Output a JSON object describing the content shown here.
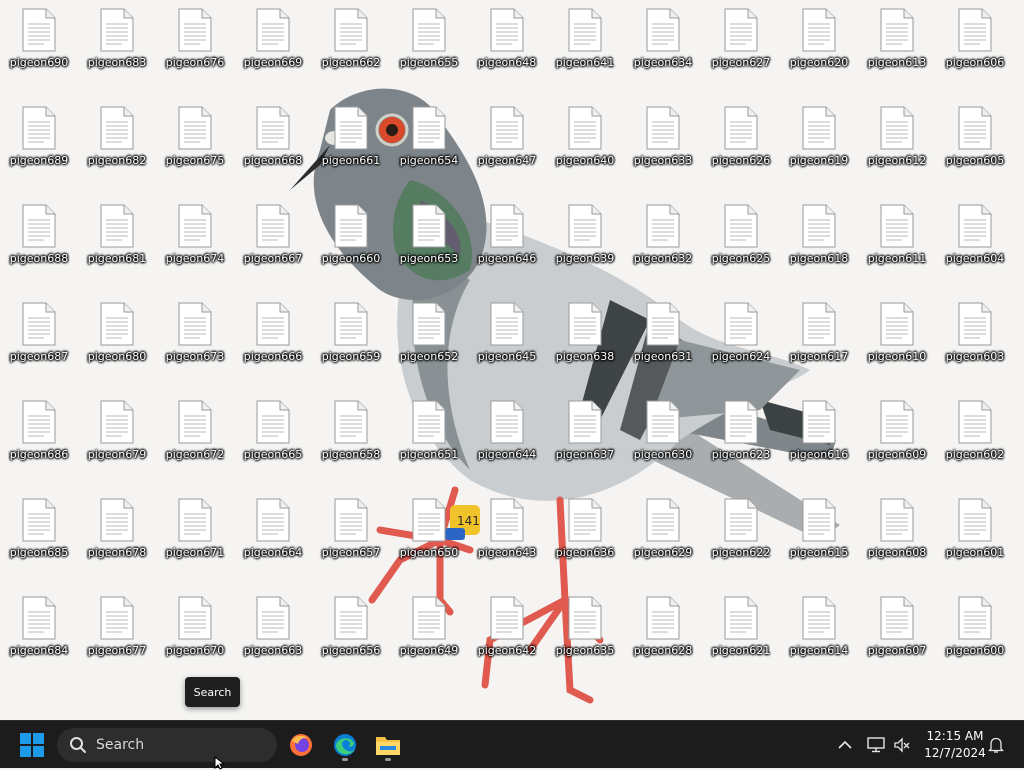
{
  "desktop": {
    "columns": [
      [
        "pigeon690",
        "pigeon689",
        "pigeon688",
        "pigeon687",
        "pigeon686",
        "pigeon685",
        "pigeon684"
      ],
      [
        "pigeon683",
        "pigeon682",
        "pigeon681",
        "pigeon680",
        "pigeon679",
        "pigeon678",
        "pigeon677"
      ],
      [
        "pigeon676",
        "pigeon675",
        "pigeon674",
        "pigeon673",
        "pigeon672",
        "pigeon671",
        "pigeon670"
      ],
      [
        "pigeon669",
        "pigeon668",
        "pigeon667",
        "pigeon666",
        "pigeon665",
        "pigeon664",
        "pigeon663"
      ],
      [
        "pigeon662",
        "pigeon661",
        "pigeon660",
        "pigeon659",
        "pigeon658",
        "pigeon657",
        "pigeon656"
      ],
      [
        "pigeon655",
        "pigeon654",
        "pigeon653",
        "pigeon652",
        "pigeon651",
        "pigeon650",
        "pigeon649"
      ],
      [
        "pigeon648",
        "pigeon647",
        "pigeon646",
        "pigeon645",
        "pigeon644",
        "pigeon643",
        "pigeon642"
      ],
      [
        "pigeon641",
        "pigeon640",
        "pigeon639",
        "pigeon638",
        "pigeon637",
        "pigeon636",
        "pigeon635"
      ],
      [
        "pigeon634",
        "pigeon633",
        "pigeon632",
        "pigeon631",
        "pigeon630",
        "pigeon629",
        "pigeon628"
      ],
      [
        "pigeon627",
        "pigeon626",
        "pigeon625",
        "pigeon624",
        "pigeon623",
        "pigeon622",
        "pigeon621"
      ],
      [
        "pigeon620",
        "pigeon619",
        "pigeon618",
        "pigeon617",
        "pigeon616",
        "pigeon615",
        "pigeon614"
      ],
      [
        "pigeon613",
        "pigeon612",
        "pigeon611",
        "pigeon610",
        "pigeon609",
        "pigeon608",
        "pigeon607"
      ],
      [
        "pigeon606",
        "pigeon605",
        "pigeon604",
        "pigeon603",
        "pigeon602",
        "pigeon601",
        "pigeon600"
      ]
    ],
    "file_icon": "text-document-icon",
    "wallpaper": "pigeon-photo",
    "leg_band_text": "141"
  },
  "tooltip": {
    "text": "Search"
  },
  "taskbar": {
    "start_icon": "windows-start-icon",
    "search_placeholder": "Search",
    "apps": [
      {
        "name": "Firefox",
        "icon": "firefox-icon",
        "running": false
      },
      {
        "name": "Microsoft Edge",
        "icon": "edge-icon",
        "running": true
      },
      {
        "name": "File Explorer",
        "icon": "file-explorer-icon",
        "running": true
      }
    ],
    "tray": {
      "overflow_icon": "chevron-up-icon",
      "network_icon": "network-icon",
      "volume_icon": "volume-muted-icon",
      "time": "12:15 AM",
      "date": "12/7/2024",
      "notification_icon": "bell-icon"
    }
  },
  "colors": {
    "taskbar_bg": "#1c1c1c",
    "start_blue": "#1e9be8",
    "pigeon_grey": "#8f969a",
    "legs": "#e05a4f"
  }
}
